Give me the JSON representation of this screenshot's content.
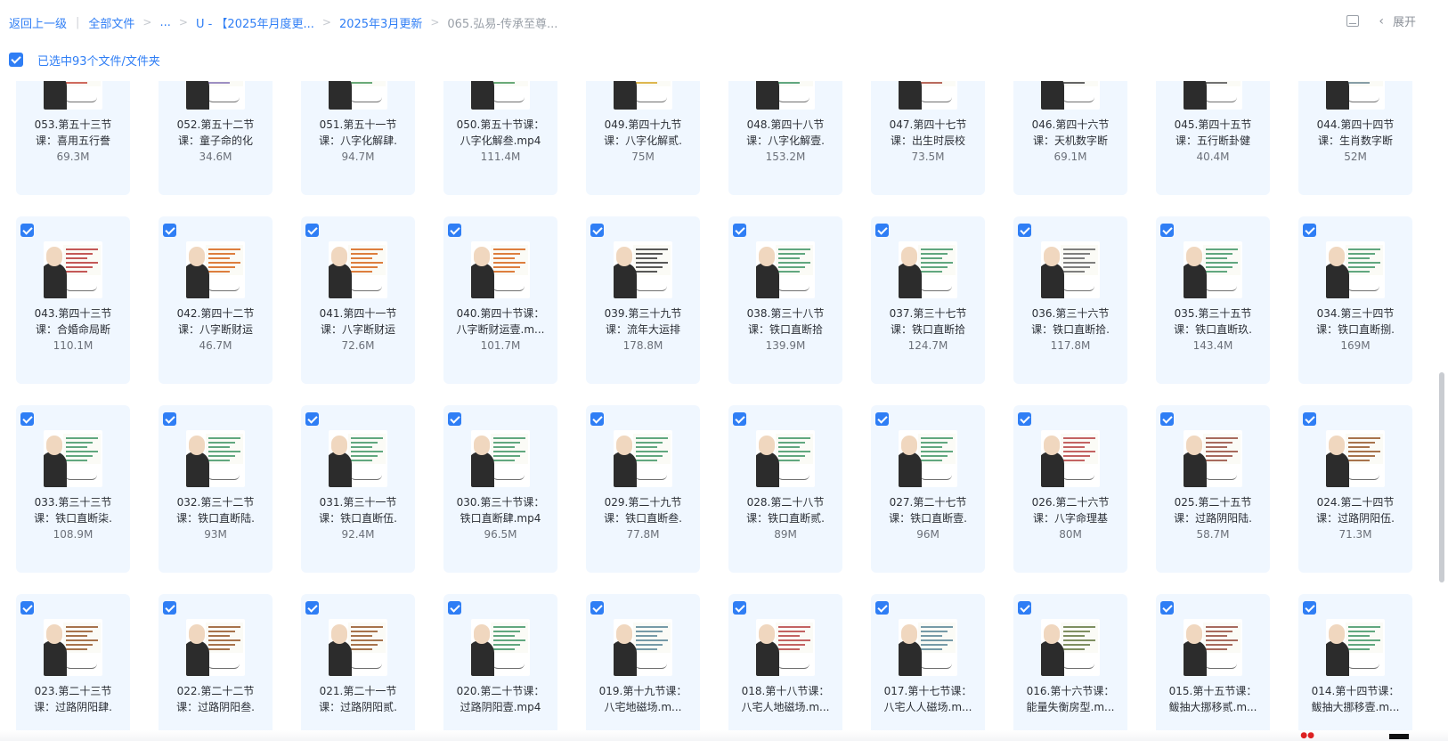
{
  "breadcrumb": {
    "back": "返回上一级",
    "pipe": "|",
    "sep": ">",
    "items": [
      {
        "label": "全部文件"
      },
      {
        "label": "..."
      },
      {
        "label": "U - 【2025年月度更..."
      },
      {
        "label": "2025年3月更新"
      }
    ],
    "current": "065.弘易-传承至尊..."
  },
  "top_right": {
    "list_icon": "list-view-icon",
    "chevron": "‹",
    "expand_label": "展开"
  },
  "selection": {
    "checked": true,
    "text": "已选中93个文件/文件夹"
  },
  "accent_color": "#2f7ef5",
  "files": [
    {
      "line1": "053.第五十三节",
      "line2": "课：喜用五行誊",
      "size": "69.3M",
      "slide": "#c0392b"
    },
    {
      "line1": "052.第五十二节",
      "line2": "课：童子命的化",
      "size": "34.6M",
      "slide": "#7d6bb0"
    },
    {
      "line1": "051.第五十一节",
      "line2": "课：八字化解肆.",
      "size": "94.7M",
      "slide": "#3a8f4e"
    },
    {
      "line1": "050.第五十节课：",
      "line2": "八字化解叁.mp4",
      "size": "111.4M",
      "slide": "#3a8f4e"
    },
    {
      "line1": "049.第四十九节",
      "line2": "课：八字化解贰.",
      "size": "75M",
      "slide": "#d4a017"
    },
    {
      "line1": "048.第四十八节",
      "line2": "课：八字化解壹.",
      "size": "153.2M",
      "slide": "#2e8b57"
    },
    {
      "line1": "047.第四十七节",
      "line2": "课：出生时辰校",
      "size": "73.5M",
      "slide": "#a33a2a"
    },
    {
      "line1": "046.第四十六节",
      "line2": "课：天机数字断",
      "size": "69.1M",
      "slide": "#333333"
    },
    {
      "line1": "045.第四十五节",
      "line2": "课：五行断卦健",
      "size": "40.4M",
      "slide": "#444444"
    },
    {
      "line1": "044.第四十四节",
      "line2": "课：生肖数字断",
      "size": "52M",
      "slide": "#607d8b"
    },
    {
      "line1": "043.第四十三节",
      "line2": "课：合婚命局断",
      "size": "110.1M",
      "slide": "#b22222"
    },
    {
      "line1": "042.第四十二节",
      "line2": "课：八字断财运",
      "size": "46.7M",
      "slide": "#d35400"
    },
    {
      "line1": "041.第四十一节",
      "line2": "课：八字断财运",
      "size": "72.6M",
      "slide": "#d35400"
    },
    {
      "line1": "040.第四十节课：",
      "line2": "八字断财运壹.m...",
      "size": "101.7M",
      "slide": "#d35400"
    },
    {
      "line1": "039.第三十九节",
      "line2": "课：流年大运排",
      "size": "178.8M",
      "slide": "#222222"
    },
    {
      "line1": "038.第三十八节",
      "line2": "课：铁口直断拾",
      "size": "139.9M",
      "slide": "#2e8b57"
    },
    {
      "line1": "037.第三十七节",
      "line2": "课：铁口直断拾",
      "size": "124.7M",
      "slide": "#2e8b57"
    },
    {
      "line1": "036.第三十六节",
      "line2": "课：铁口直断拾.",
      "size": "117.8M",
      "slide": "#555555"
    },
    {
      "line1": "035.第三十五节",
      "line2": "课：铁口直断玖.",
      "size": "143.4M",
      "slide": "#2e8b57"
    },
    {
      "line1": "034.第三十四节",
      "line2": "课：铁口直断捌.",
      "size": "169M",
      "slide": "#2e8b57"
    },
    {
      "line1": "033.第三十三节",
      "line2": "课：铁口直断柒.",
      "size": "108.9M",
      "slide": "#2e8b57"
    },
    {
      "line1": "032.第三十二节",
      "line2": "课：铁口直断陆.",
      "size": "93M",
      "slide": "#2e8b57"
    },
    {
      "line1": "031.第三十一节",
      "line2": "课：铁口直断伍.",
      "size": "92.4M",
      "slide": "#2e8b57"
    },
    {
      "line1": "030.第三十节课：",
      "line2": "铁口直断肆.mp4",
      "size": "96.5M",
      "slide": "#2e8b57"
    },
    {
      "line1": "029.第二十九节",
      "line2": "课：铁口直断叁.",
      "size": "77.8M",
      "slide": "#2e8b57"
    },
    {
      "line1": "028.第二十八节",
      "line2": "课：铁口直断贰.",
      "size": "89M",
      "slide": "#2e8b57"
    },
    {
      "line1": "027.第二十七节",
      "line2": "课：铁口直断壹.",
      "size": "96M",
      "slide": "#2e8b57"
    },
    {
      "line1": "026.第二十六节",
      "line2": "课：八字命理基",
      "size": "80M",
      "slide": "#b03030"
    },
    {
      "line1": "025.第二十五节",
      "line2": "课：过路阴阳陆.",
      "size": "58.7M",
      "slide": "#8b3a2a"
    },
    {
      "line1": "024.第二十四节",
      "line2": "课：过路阴阳伍.",
      "size": "71.3M",
      "slide": "#8b4513"
    },
    {
      "line1": "023.第二十三节",
      "line2": "课：过路阴阳肆.",
      "size": "",
      "slide": "#8b4513"
    },
    {
      "line1": "022.第二十二节",
      "line2": "课：过路阴阳叁.",
      "size": "",
      "slide": "#8b4513"
    },
    {
      "line1": "021.第二十一节",
      "line2": "课：过路阴阳贰.",
      "size": "",
      "slide": "#8b4513"
    },
    {
      "line1": "020.第二十节课：",
      "line2": "过路阴阳壹.mp4",
      "size": "",
      "slide": "#2e8b57"
    },
    {
      "line1": "019.第十九节课：",
      "line2": "八宅地磁场.m...",
      "size": "",
      "slide": "#4a7a8c"
    },
    {
      "line1": "018.第十八节课：",
      "line2": "八宅人地磁场.m...",
      "size": "",
      "slide": "#b03030"
    },
    {
      "line1": "017.第十七节课：",
      "line2": "八宅人人磁场.m...",
      "size": "",
      "slide": "#4a7a8c"
    },
    {
      "line1": "016.第十六节课：",
      "line2": "能量失衡房型.m...",
      "size": "",
      "slide": "#556b2f"
    },
    {
      "line1": "015.第十五节课：",
      "line2": "鲅抽大挪移贰.m...",
      "size": "",
      "slide": "#8b3a2a"
    },
    {
      "line1": "014.第十四节课：",
      "line2": "鲅抽大挪移壹.m...",
      "size": "",
      "slide": "#2e8b57"
    }
  ]
}
